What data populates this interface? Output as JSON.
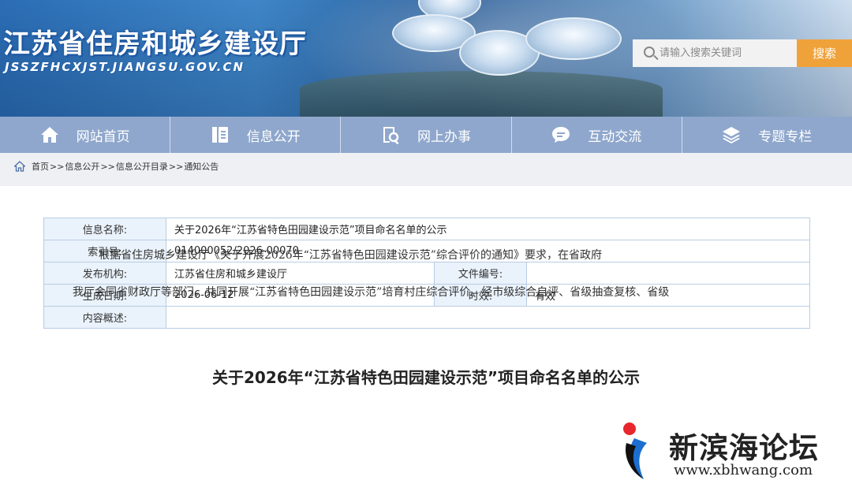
{
  "header": {
    "site_title": "江苏省住房和城乡建设厅",
    "site_domain": "JSSZFHCXJST.JIANGSU.GOV.CN",
    "search_placeholder": "请输入搜索关键词",
    "search_button": "搜索",
    "accent_color": "#f0a23a"
  },
  "nav": {
    "items": [
      {
        "label": "网站首页",
        "icon": "home-icon"
      },
      {
        "label": "信息公开",
        "icon": "document-icon"
      },
      {
        "label": "网上办事",
        "icon": "search-document-icon"
      },
      {
        "label": "互动交流",
        "icon": "chat-icon"
      },
      {
        "label": "专题专栏",
        "icon": "layers-icon"
      }
    ],
    "bg_color": "#8fa7cc"
  },
  "breadcrumb": {
    "items": [
      "首页",
      "信息公开",
      "信息公开目录",
      "通知公告"
    ],
    "separator": ">>"
  },
  "meta_table": {
    "name_label": "信息名称:",
    "name_value": "关于2026年“江苏省特色田园建设示范”项目命名名单的公示",
    "index_label": "索引号:",
    "index_value": "014000052/2026-00070",
    "org_label": "发布机构:",
    "org_value": "江苏省住房和城乡建设厅",
    "docno_label": "文件编号:",
    "docno_value": "",
    "date_label": "生成日期:",
    "date_value": "2026-06-12",
    "valid_label": "时效:",
    "valid_value": "有效",
    "summary_label": "内容概述:",
    "summary_value": ""
  },
  "article": {
    "title": "关于2026年“江苏省特色田园建设示范”项目命名名单的公示",
    "para1": "根据省住房城乡建设厅《关于开展2026年“江苏省特色田园建设示范”综合评价的通知》要求，在省政府",
    "para2": "我厅会同省财政厅等部门，共同开展“江苏省特色田园建设示范”培育村庄综合评价。经市级综合自评、省级抽查复核、省级"
  },
  "watermark": {
    "title": "新滨海论坛",
    "url": "www.xbhwang.com"
  }
}
